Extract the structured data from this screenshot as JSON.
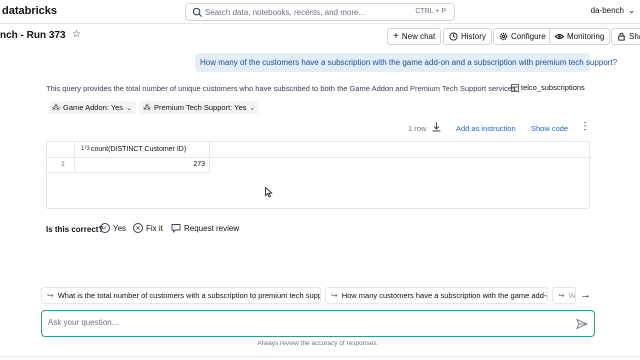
{
  "topbar": {
    "logo": "databricks",
    "search_placeholder": "Search data, notebooks, recents, and more...",
    "search_shortcut": "CTRL + P",
    "user": "da-bench"
  },
  "header": {
    "title": "nch - Run 373",
    "buttons": {
      "new_chat": "New chat",
      "history": "History",
      "configure": "Configure",
      "monitoring": "Monitoring",
      "share": "Sha"
    }
  },
  "conversation": {
    "question": "How many of the customers have a subscription with the game add-on and a subscription with premium tech support?",
    "description": "This query provides the total number of unique customers who have subscribed to both the Game Addon and Premium Tech Support services.",
    "table_ref": "telco_subscriptions",
    "filters": [
      {
        "label": "Game Addon: Yes"
      },
      {
        "label": "Premium Tech Support: Yes"
      }
    ],
    "result_meta": {
      "row_count": "1 row",
      "add_instruction": "Add as instruction",
      "show_code": "Show code"
    },
    "result_table": {
      "column_icon": "1²3",
      "column": "count(DISTINCT Customer ID)",
      "rows": [
        {
          "index": "1",
          "value": "273"
        }
      ]
    },
    "feedback": {
      "question": "Is this correct?",
      "yes": "Yes",
      "fix": "Fix it",
      "review": "Request review"
    }
  },
  "suggestions": [
    "What is the total number of customers with a subscription to premium tech support?",
    "How many customers have a subscription with the game add-on?",
    "W"
  ],
  "input": {
    "placeholder": "Ask your question...",
    "disclaimer": "Always review the accuracy of responses."
  },
  "colors": {
    "accent_link": "#2266cc",
    "bubble_bg": "#e3eefb",
    "input_border": "#2a9d8f"
  }
}
